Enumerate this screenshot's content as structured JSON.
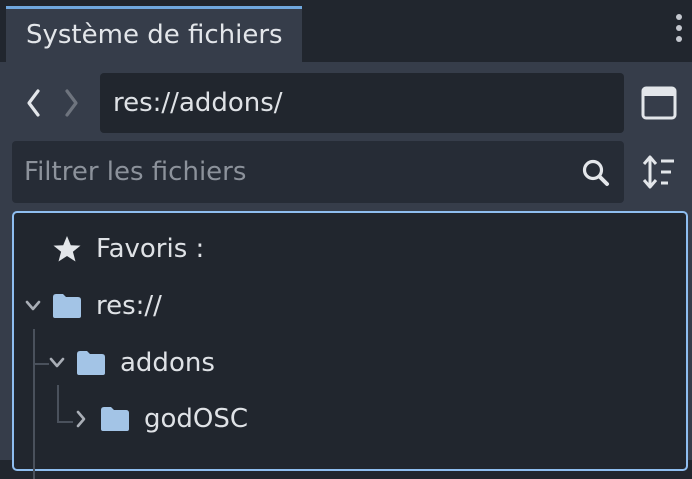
{
  "panel": {
    "tab_label": "Système de fichiers"
  },
  "toolbar": {
    "current_path": "res://addons/",
    "filter_placeholder": "Filtrer les fichiers"
  },
  "tree": {
    "favorites_label": "Favoris :",
    "items": [
      {
        "label": "res://",
        "icon": "folder-icon",
        "expanded": true
      },
      {
        "label": "addons",
        "icon": "folder-icon",
        "expanded": true
      },
      {
        "label": "godOSC",
        "icon": "folder-icon",
        "expanded": false
      }
    ]
  },
  "colors": {
    "background": "#21262e",
    "panel": "#363d4a",
    "accent": "#70a8df",
    "focus_border": "#8fbef0",
    "folder": "#a3c4e6",
    "text": "#dfe2e6"
  }
}
